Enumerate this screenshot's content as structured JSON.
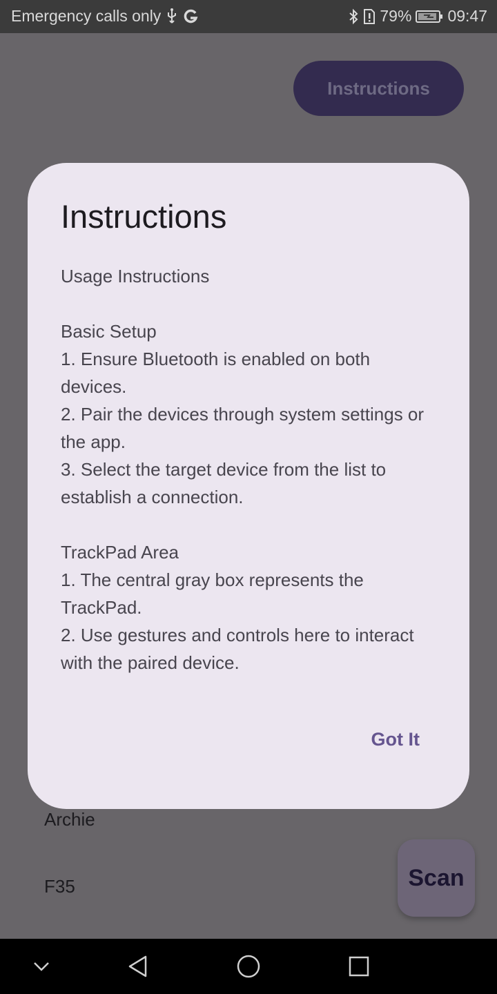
{
  "status_bar": {
    "carrier_text": "Emergency calls only",
    "battery": "79%",
    "time": "09:47"
  },
  "background": {
    "instructions_button": "Instructions",
    "devices": [
      "Archie",
      "F35"
    ],
    "scan_button": "Scan"
  },
  "dialog": {
    "title": "Instructions",
    "heading": "Usage Instructions",
    "basic_setup": {
      "title": "Basic Setup",
      "steps": [
        "1. Ensure Bluetooth is enabled on both devices.",
        "2. Pair the devices through system settings or the app.",
        "3. Select the target device from the list to establish a connection."
      ]
    },
    "trackpad": {
      "title": "TrackPad Area",
      "steps": [
        "1. The central gray box represents the TrackPad.",
        "2. Use gestures and controls here to interact with the paired device."
      ]
    },
    "confirm_button": "Got It"
  },
  "icons": {
    "usb": "usb-icon",
    "google": "google-icon",
    "bluetooth": "bluetooth-icon",
    "sim_alert": "sim-alert-icon",
    "battery": "battery-icon"
  },
  "colors": {
    "accent": "#65558f",
    "dialog_bg": "#ece6f0",
    "scrim": "#686569"
  }
}
